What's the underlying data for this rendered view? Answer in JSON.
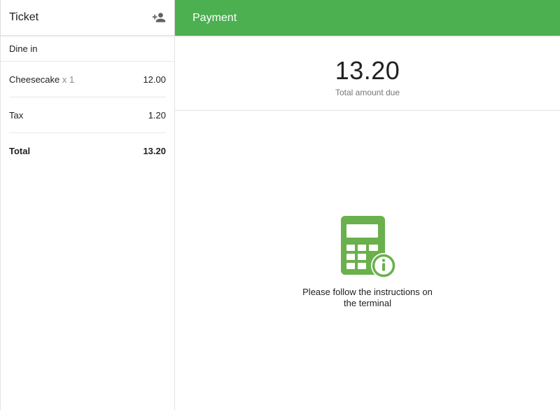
{
  "ticket": {
    "title": "Ticket",
    "dining_option": "Dine in",
    "items": [
      {
        "name": "Cheesecake",
        "qty": "x 1",
        "price": "12.00"
      }
    ],
    "tax": {
      "label": "Tax",
      "value": "1.20"
    },
    "total": {
      "label": "Total",
      "value": "13.20"
    }
  },
  "payment": {
    "title": "Payment",
    "amount": "13.20",
    "amount_label": "Total amount due",
    "instruction_line1": "Please follow the instructions on",
    "instruction_line2": "the terminal"
  },
  "icons": {
    "add_customer": "add-customer-icon",
    "terminal": "calculator-info-icon"
  },
  "colors": {
    "accent": "#4caf50",
    "terminal_icon": "#6ab04c"
  }
}
